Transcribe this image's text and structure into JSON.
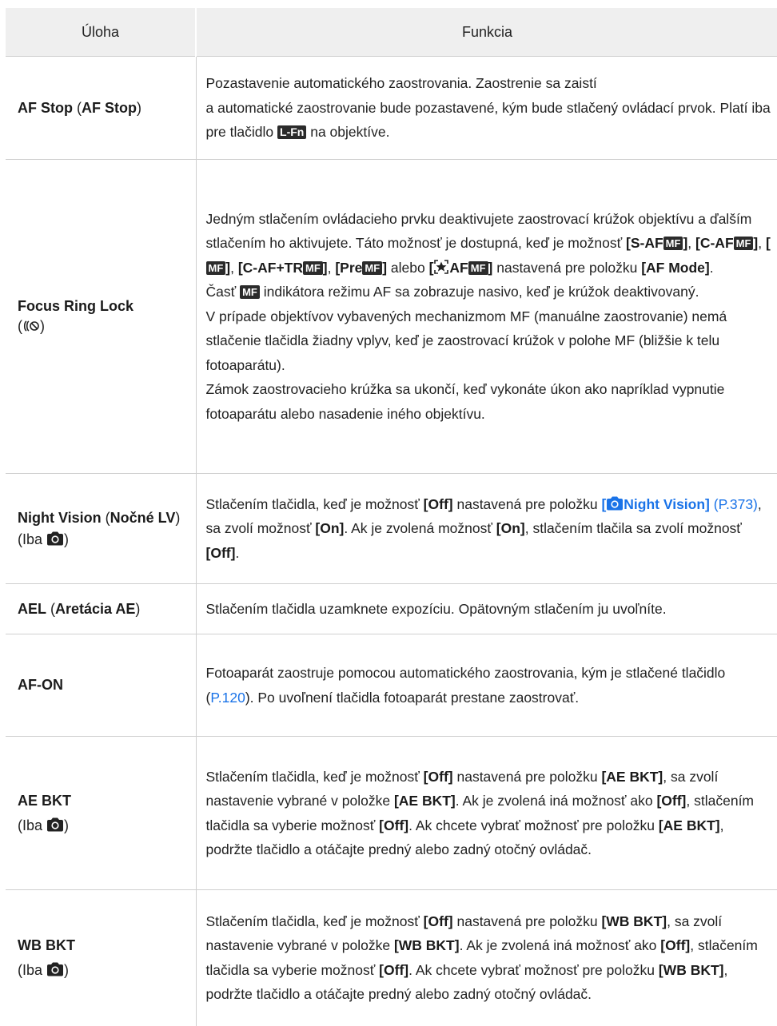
{
  "header": {
    "col_task": "Úloha",
    "col_function": "Funkcia"
  },
  "icons": {
    "camera": "camera-icon",
    "lfn": "L-Fn",
    "mf": "MF",
    "focus_ring_lock": "focus-ring-lock-icon",
    "star": "star-af-icon"
  },
  "colors": {
    "link": "#1a73e8",
    "header_bg": "#efefef",
    "border": "#cfcfcf"
  },
  "rows": {
    "af_stop": {
      "name": "AF Stop",
      "name_local": "AF Stop",
      "text1": "Pozastavenie automatického zaostrovania. Zaostrenie sa zaistí",
      "text2": "a automatické zaostrovanie bude pozastavené, kým bude stlačený ovládací prvok. Platí iba pre tlačidlo",
      "text3": "na objektíve."
    },
    "focus_ring": {
      "name": "Focus Ring Lock",
      "t1": "Jedným stlačením ovládacieho prvku deaktivujete zaostrovací krúžok objektívu a ďalším stlačením ho aktivujete. Táto možnosť je dostupná, keď je možnosť",
      "opt1": "[S-AF",
      "opt2": "[C-AF",
      "opt3": "[",
      "opt4": "[C-AF+TR",
      "opt5": "[Pre",
      "alebo": "alebo",
      "opt6": "AF",
      "t2": "nastavená pre položku",
      "af_mode": "[AF Mode]",
      "t3a": "Časť",
      "t3b": "indikátora režimu AF sa zobrazuje nasivo, keď je krúžok deaktivovaný.",
      "t4": "V prípade objektívov vybavených mechanizmom MF (manuálne zaostrovanie) nemá stlačenie tlačidla žiadny vplyv, keď je zaostrovací krúžok v polohe MF (bližšie k telu fotoaparátu).",
      "t5": "Zámok zaostrovacieho krúžka sa ukončí, keď vykonáte úkon ako napríklad vypnutie fotoaparátu alebo nasadenie iného objektívu."
    },
    "night_vision": {
      "name": "Night Vision",
      "name_local": "Nočné LV",
      "iba": "(Iba",
      "t1": "Stlačením tlačidla, keď je možnosť",
      "off": "[Off]",
      "t2": "nastavená pre položku",
      "link_open": "[",
      "link_label": "Night Vision]",
      "page": "(P.373)",
      "t3": ", sa zvolí možnosť",
      "on": "[On]",
      "t4": ". Ak je zvolená možnosť",
      "t5": ", stlačením tlačila sa zvolí možnosť"
    },
    "ael": {
      "name": "AEL",
      "name_local": "Aretácia AE",
      "text": "Stlačením tlačidla uzamknete expozíciu. Opätovným stlačením ju uvoľníte."
    },
    "af_on": {
      "name": "AF-ON",
      "t1": "Fotoaparát zaostruje pomocou automatického zaostrovania, kým je stlačené tlačidlo (",
      "page": "P.120",
      "t2": "). Po uvoľnení tlačidla fotoaparát prestane zaostrovať."
    },
    "ae_bkt": {
      "name": "AE BKT",
      "iba": "(Iba",
      "t1": "Stlačením tlačidla, keď je možnosť",
      "off": "[Off]",
      "t2": "nastavená pre položku",
      "item": "[AE BKT]",
      "t3": ", sa zvolí nastavenie vybrané v položke",
      "t4": ". Ak je zvolená iná možnosť ako",
      "t5": ", stlačením tlačidla sa vyberie možnosť",
      "t6": ". Ak chcete vybrať možnosť pre položku",
      "t7": ", podržte tlačidlo a otáčajte predný alebo zadný otočný ovládač."
    },
    "wb_bkt": {
      "name": "WB BKT",
      "iba": "(Iba",
      "t1": "Stlačením tlačidla, keď je možnosť",
      "off": "[Off]",
      "t2": "nastavená pre položku",
      "item": "[WB BKT]",
      "t3": ", sa zvolí nastavenie vybrané v položke",
      "t4": ". Ak je zvolená iná možnosť ako",
      "t5": ", stlačením tlačidla sa vyberie možnosť",
      "t6": ". Ak chcete vybrať možnosť pre položku",
      "t7": ", podržte tlačidlo a otáčajte predný alebo zadný otočný ovládač."
    }
  }
}
